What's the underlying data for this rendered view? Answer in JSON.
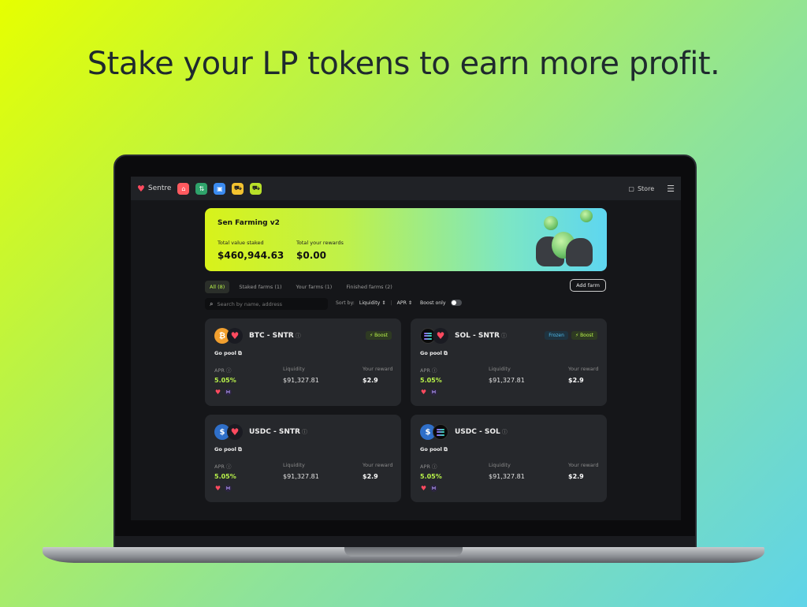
{
  "headline": "Stake your LP tokens to earn more profit.",
  "topbar": {
    "brand": "Sentre",
    "apps": [
      {
        "icon": "home-icon",
        "color": "#ff5a5f"
      },
      {
        "icon": "swap-icon",
        "color": "#2fa36b"
      },
      {
        "icon": "wallet-icon",
        "color": "#3b8bf0"
      },
      {
        "icon": "tractor-icon",
        "color": "#f2c230"
      },
      {
        "icon": "tractor-icon",
        "color": "#b8e02a"
      }
    ],
    "store": "Store"
  },
  "hero": {
    "title": "Sen Farming v2",
    "tvl_label": "Total value staked",
    "tvl_value": "$460,944.63",
    "rewards_label": "Total your rewards",
    "rewards_value": "$0.00"
  },
  "tabs": [
    "All (8)",
    "Staked farms (1)",
    "Your farms (1)",
    "Finished farms (2)"
  ],
  "add_farm": "Add farm",
  "search": {
    "placeholder": "Search by name, address"
  },
  "sort": {
    "label": "Sort by:",
    "option1": "Liquidity",
    "option2": "APR",
    "boost_only": "Boost only"
  },
  "cards": [
    {
      "pair": "BTC - SNTR",
      "go_pool": "Go pool",
      "badges": [
        "Boost"
      ],
      "apr_label": "APR",
      "apr": "5.05%",
      "liq_label": "Liquidity",
      "liquidity": "$91,327.81",
      "reward_label": "Your reward",
      "reward": "$2.9"
    },
    {
      "pair": "SOL - SNTR",
      "go_pool": "Go pool",
      "badges": [
        "Frozen",
        "Boost"
      ],
      "apr_label": "APR",
      "apr": "5.05%",
      "liq_label": "Liquidity",
      "liquidity": "$91,327.81",
      "reward_label": "Your reward",
      "reward": "$2.9"
    },
    {
      "pair": "USDC - SNTR",
      "go_pool": "Go pool",
      "badges": [],
      "apr_label": "APR",
      "apr": "5.05%",
      "liq_label": "Liquidity",
      "liquidity": "$91,327.81",
      "reward_label": "Your reward",
      "reward": "$2.9"
    },
    {
      "pair": "USDC - SOL",
      "go_pool": "Go pool",
      "badges": [],
      "apr_label": "APR",
      "apr": "5.05%",
      "liq_label": "Liquidity",
      "liquidity": "$91,327.81",
      "reward_label": "Your reward",
      "reward": "$2.9"
    }
  ]
}
